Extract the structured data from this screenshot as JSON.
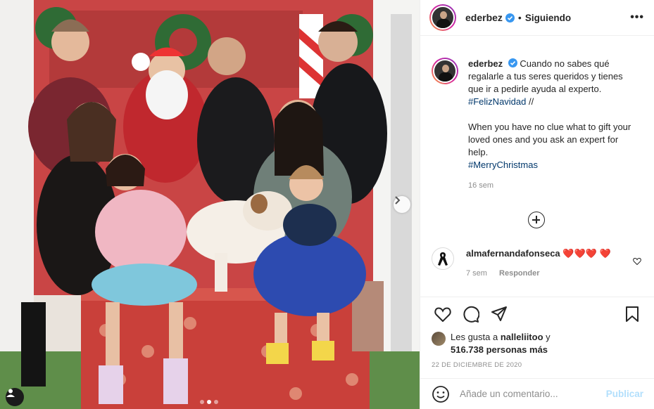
{
  "post": {
    "username": "ederbez",
    "follow_status": "Siguiendo",
    "caption_lines": [
      "Cuando no sabes qué regalarle a tus seres queridos y tienes que ir a pedirle ayuda al experto."
    ],
    "hashtag_es": "#FelizNavidad",
    "caption_sep": "//",
    "caption_en": "When you have no clue what to gift your loved ones and you ask an expert for help.",
    "hashtag_en": "#MerryChristmas",
    "time_ago": "16 sem",
    "date": "22 DE DICIEMBRE DE 2020"
  },
  "comment": {
    "username": "almafernandafonseca",
    "hearts": "❤️❤️❤️ ❤️",
    "time_ago": "7 sem",
    "reply_label": "Responder"
  },
  "likes": {
    "prefix": "Les gusta a",
    "user": "nalleliitoo",
    "connector": "y",
    "count_text": "516.738 personas más"
  },
  "composer": {
    "placeholder": "Añade un comentario...",
    "publish_label": "Publicar"
  },
  "carousel": {
    "total": 3,
    "active": 2
  },
  "colors": {
    "verified": "#3897f0",
    "link": "#00376b",
    "muted": "#8e8e8e",
    "publish_disabled": "#b2dffc"
  }
}
